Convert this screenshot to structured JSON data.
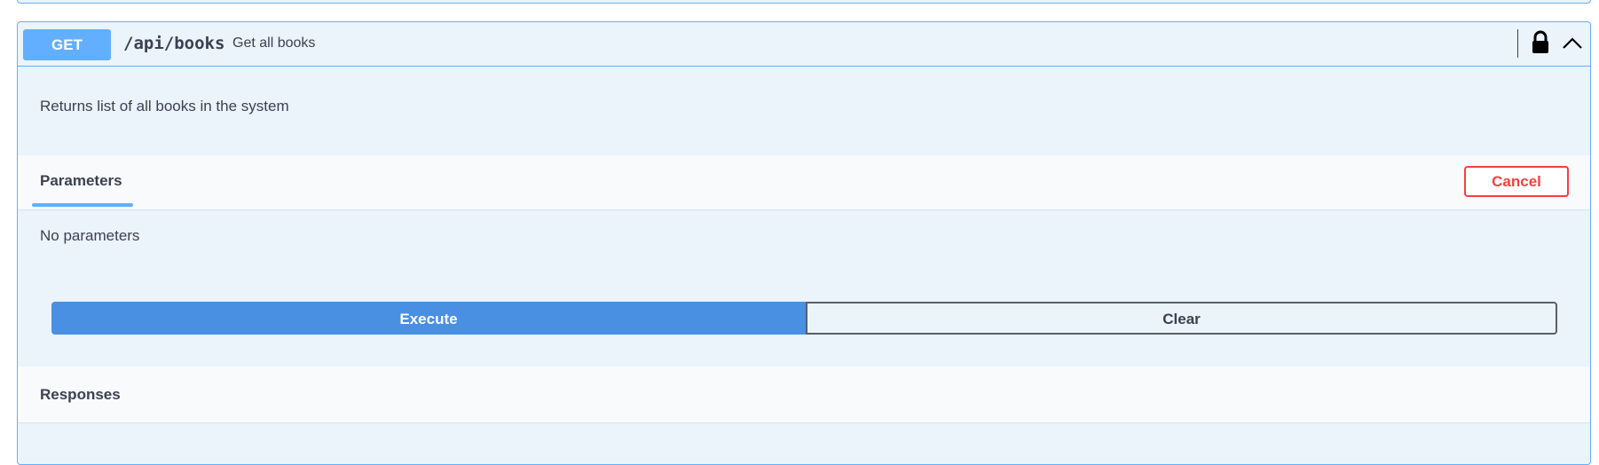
{
  "operation": {
    "method": "GET",
    "path": "/api/books",
    "summary": "Get all books",
    "description": "Returns list of all books in the system"
  },
  "parameters": {
    "tab_label": "Parameters",
    "cancel_label": "Cancel",
    "empty_text": "No parameters"
  },
  "actions": {
    "execute_label": "Execute",
    "clear_label": "Clear"
  },
  "responses": {
    "label": "Responses"
  },
  "icons": {
    "lock": "lock-icon",
    "collapse": "chevron-up-icon"
  },
  "colors": {
    "get_accent": "#61affe",
    "execute": "#4990e2",
    "cancel": "#f93e3e"
  }
}
